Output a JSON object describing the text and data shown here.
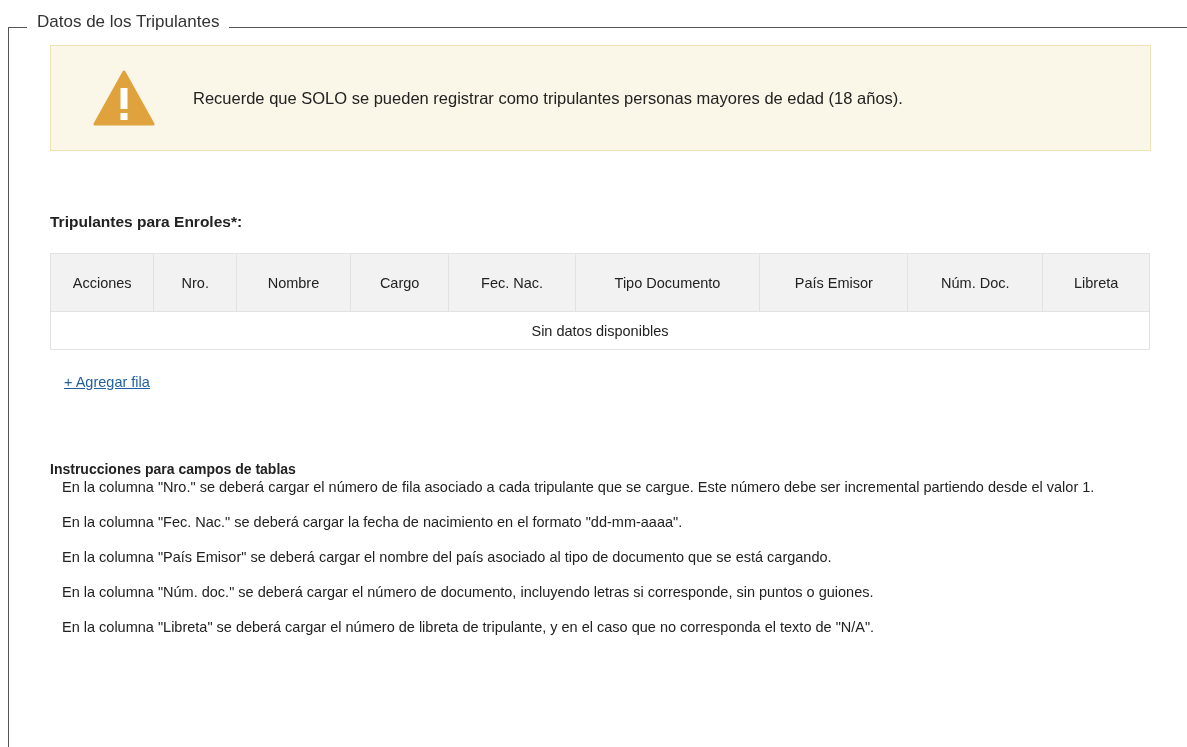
{
  "section": {
    "legend": "Datos de los Tripulantes"
  },
  "alert": {
    "text": "Recuerde que SOLO se pueden registrar como tripulantes personas mayores de edad (18 años)."
  },
  "table": {
    "title": "Tripulantes para Enroles*:",
    "columns": [
      "Acciones",
      "Nro.",
      "Nombre",
      "Cargo",
      "Fec. Nac.",
      "Tipo Documento",
      "País Emisor",
      "Núm. Doc.",
      "Libreta"
    ],
    "empty_message": "Sin datos disponibles"
  },
  "add_row_link": "+ Agregar fila",
  "instructions": {
    "title": "Instrucciones para campos de tablas",
    "items": [
      "En la columna \"Nro.\" se deberá cargar el número de fila asociado a cada tripulante que se cargue. Este número debe ser incremental partiendo desde el valor 1.",
      "En la columna \"Fec. Nac.\" se deberá cargar la fecha de nacimiento en el formato \"dd-mm-aaaa\".",
      "En la columna \"País Emisor\" se deberá cargar el nombre del país asociado al tipo de documento que se está cargando.",
      "En la columna \"Núm. doc.\" se deberá cargar el número de documento, incluyendo letras si corresponde, sin puntos o guiones.",
      "En la columna \"Libreta\" se deberá cargar el número de libreta de tripulante, y en el caso que no corresponda el texto de \"N/A\"."
    ]
  }
}
